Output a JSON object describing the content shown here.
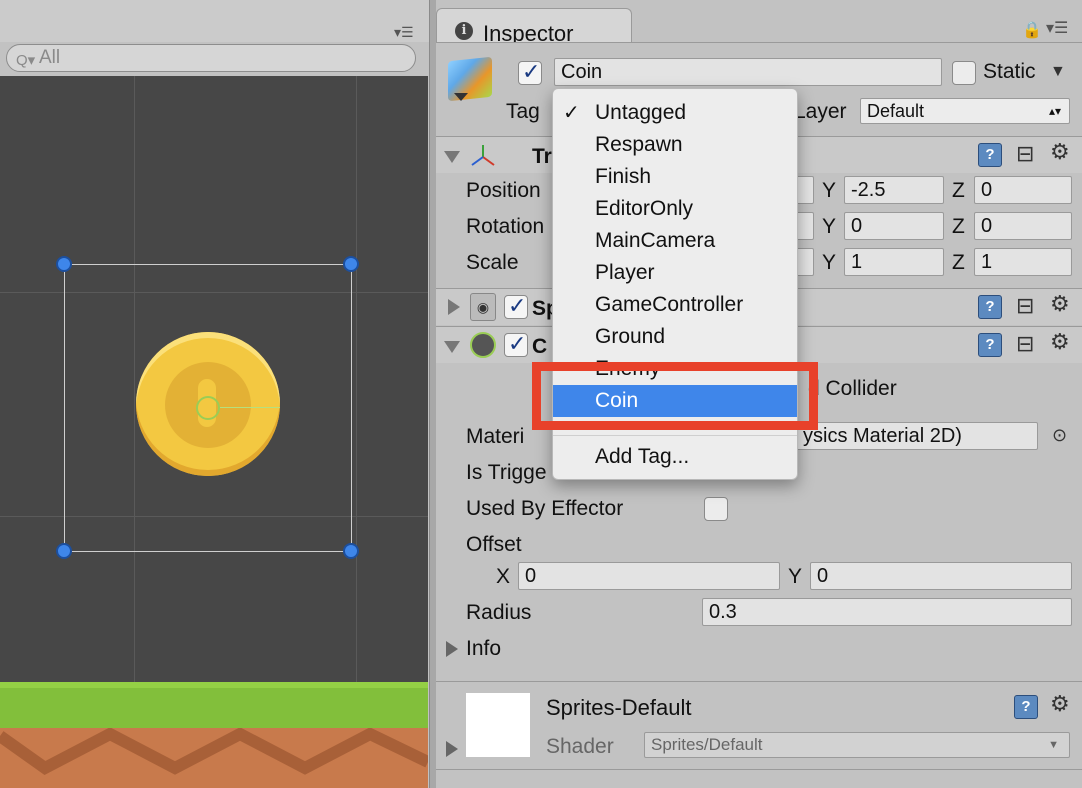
{
  "scene": {
    "search_placeholder": "All",
    "search_icon": "search-icon"
  },
  "inspector": {
    "tab_label": "Inspector",
    "tab_icon": "info-icon",
    "gameobject": {
      "active": true,
      "name": "Coin",
      "static_label": "Static",
      "static_checked": false,
      "tag_label": "Tag",
      "layer_label": "Layer",
      "layer_value": "Default"
    },
    "transform": {
      "title": "Tr",
      "position_label": "Position",
      "rotation_label": "Rotation",
      "scale_label": "Scale",
      "position": {
        "y": "-2.5",
        "z": "0"
      },
      "rotation": {
        "y": "0",
        "z": "0"
      },
      "scale": {
        "y": "1",
        "z": "1"
      },
      "y_label": "Y",
      "z_label": "Z"
    },
    "sprite_renderer": {
      "title": "Sp",
      "enabled": true
    },
    "circle_collider": {
      "title": "C",
      "enabled": true,
      "edit_label": "d Collider",
      "material_label": "Materi",
      "material_value": "ysics Material 2D)",
      "is_trigger_label": "Is Trigge",
      "used_by_effector_label": "Used By Effector",
      "used_by_effector": false,
      "offset_label": "Offset",
      "offset_x_label": "X",
      "offset_x": "0",
      "offset_y_label": "Y",
      "offset_y": "0",
      "radius_label": "Radius",
      "radius": "0.3",
      "info_label": "Info"
    },
    "material": {
      "name": "Sprites-Default",
      "shader_label": "Shader",
      "shader_value": "Sprites/Default"
    }
  },
  "tag_menu": {
    "items": [
      "Untagged",
      "Respawn",
      "Finish",
      "EditorOnly",
      "MainCamera",
      "Player",
      "GameController",
      "Ground",
      "Enemy",
      "Coin"
    ],
    "checked": "Untagged",
    "selected": "Coin",
    "add_tag": "Add Tag..."
  },
  "colors": {
    "selection": "#3f86ea",
    "highlight_box": "#e8412a",
    "coin": "#f3c841",
    "grass": "#82bf3b",
    "dirt": "#c87a4c"
  }
}
